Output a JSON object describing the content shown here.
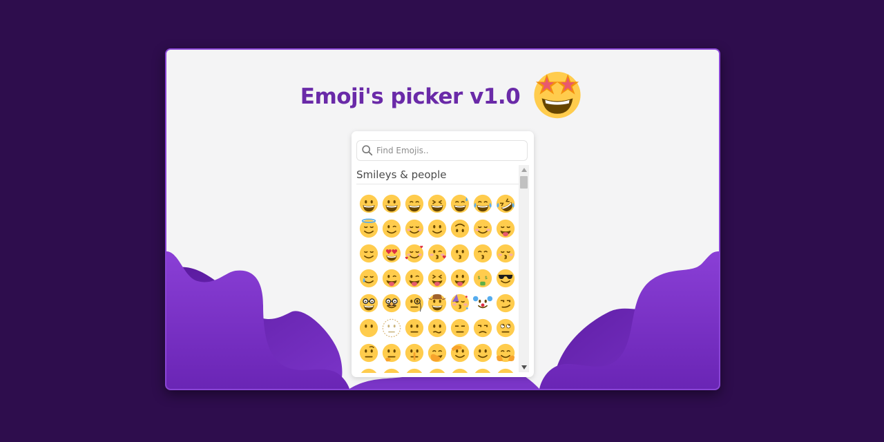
{
  "app": {
    "title": "Emoji's picker v1.0",
    "title_emoji": "star-struck"
  },
  "search": {
    "placeholder": "Find Emojis.."
  },
  "categories": [
    {
      "name": "Smileys & people",
      "emojis": [
        "grinning",
        "smiley",
        "smile",
        "laughing",
        "sweat-smile",
        "joy",
        "rofl",
        "innocent",
        "wink",
        "blush",
        "slightly-smiling",
        "upside-down",
        "relaxed",
        "yum",
        "relieved",
        "heart-eyes",
        "smiling-hearts",
        "kissing-heart",
        "kissing",
        "kissing-smiling-eyes",
        "kissing-closed-eyes",
        "smiling-tear",
        "zany",
        "winking-tongue",
        "squinting-tongue",
        "tongue",
        "money-mouth",
        "sunglasses",
        "nerd",
        "disguised",
        "monocle",
        "cowboy",
        "partying",
        "clown",
        "smirk",
        "no-mouth",
        "dotted-line",
        "neutral",
        "confused",
        "expressionless",
        "unamused",
        "rolling-eyes",
        "raised-eyebrow",
        "thinking",
        "shushing",
        "hand-over-mouth",
        "salute",
        "facepalm-face",
        "hugging",
        "row8-1",
        "row8-2",
        "row8-3",
        "row8-4",
        "row8-5",
        "row8-6",
        "row8-7"
      ]
    }
  ],
  "colors": {
    "background": "#2e0d4d",
    "card": "#f4f4f5",
    "accent": "#8a45d6",
    "title": "#6a2aa8",
    "emoji_face": "#FFCC4D"
  }
}
